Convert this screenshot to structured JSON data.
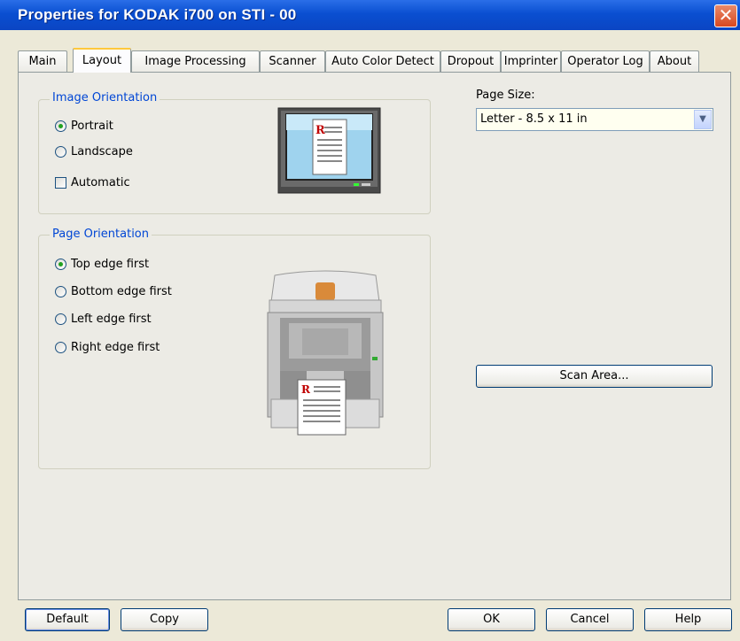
{
  "window": {
    "title": "Properties for KODAK i700 on STI - 00",
    "close_glyph": "✕"
  },
  "tabs": [
    {
      "label": "Main"
    },
    {
      "label": "Layout"
    },
    {
      "label": "Image Processing"
    },
    {
      "label": "Scanner"
    },
    {
      "label": "Auto Color Detect"
    },
    {
      "label": "Dropout"
    },
    {
      "label": "Imprinter"
    },
    {
      "label": "Operator Log"
    },
    {
      "label": "About"
    }
  ],
  "active_tab": "Layout",
  "image_orientation": {
    "label": "Image Orientation",
    "portrait": "Portrait",
    "landscape": "Landscape",
    "automatic": "Automatic",
    "selected": "Portrait",
    "automatic_checked": false
  },
  "page_orientation": {
    "label": "Page Orientation",
    "options": [
      "Top edge first",
      "Bottom edge first",
      "Left edge first",
      "Right edge first"
    ],
    "selected": "Top edge first"
  },
  "page_size": {
    "label": "Page Size:",
    "value": "Letter - 8.5 x 11 in"
  },
  "buttons": {
    "scan_area": "Scan Area...",
    "default": "Default",
    "copy": "Copy",
    "ok": "OK",
    "cancel": "Cancel",
    "help": "Help"
  },
  "preview": {
    "doc_letter": "R"
  },
  "colors": {
    "titlebar": "#0a4fd1",
    "group_label": "#0046d5",
    "panel_bg": "#ecebe5",
    "selected_tab_accent": "#ffc83c",
    "select_bg": "#fffff0"
  }
}
